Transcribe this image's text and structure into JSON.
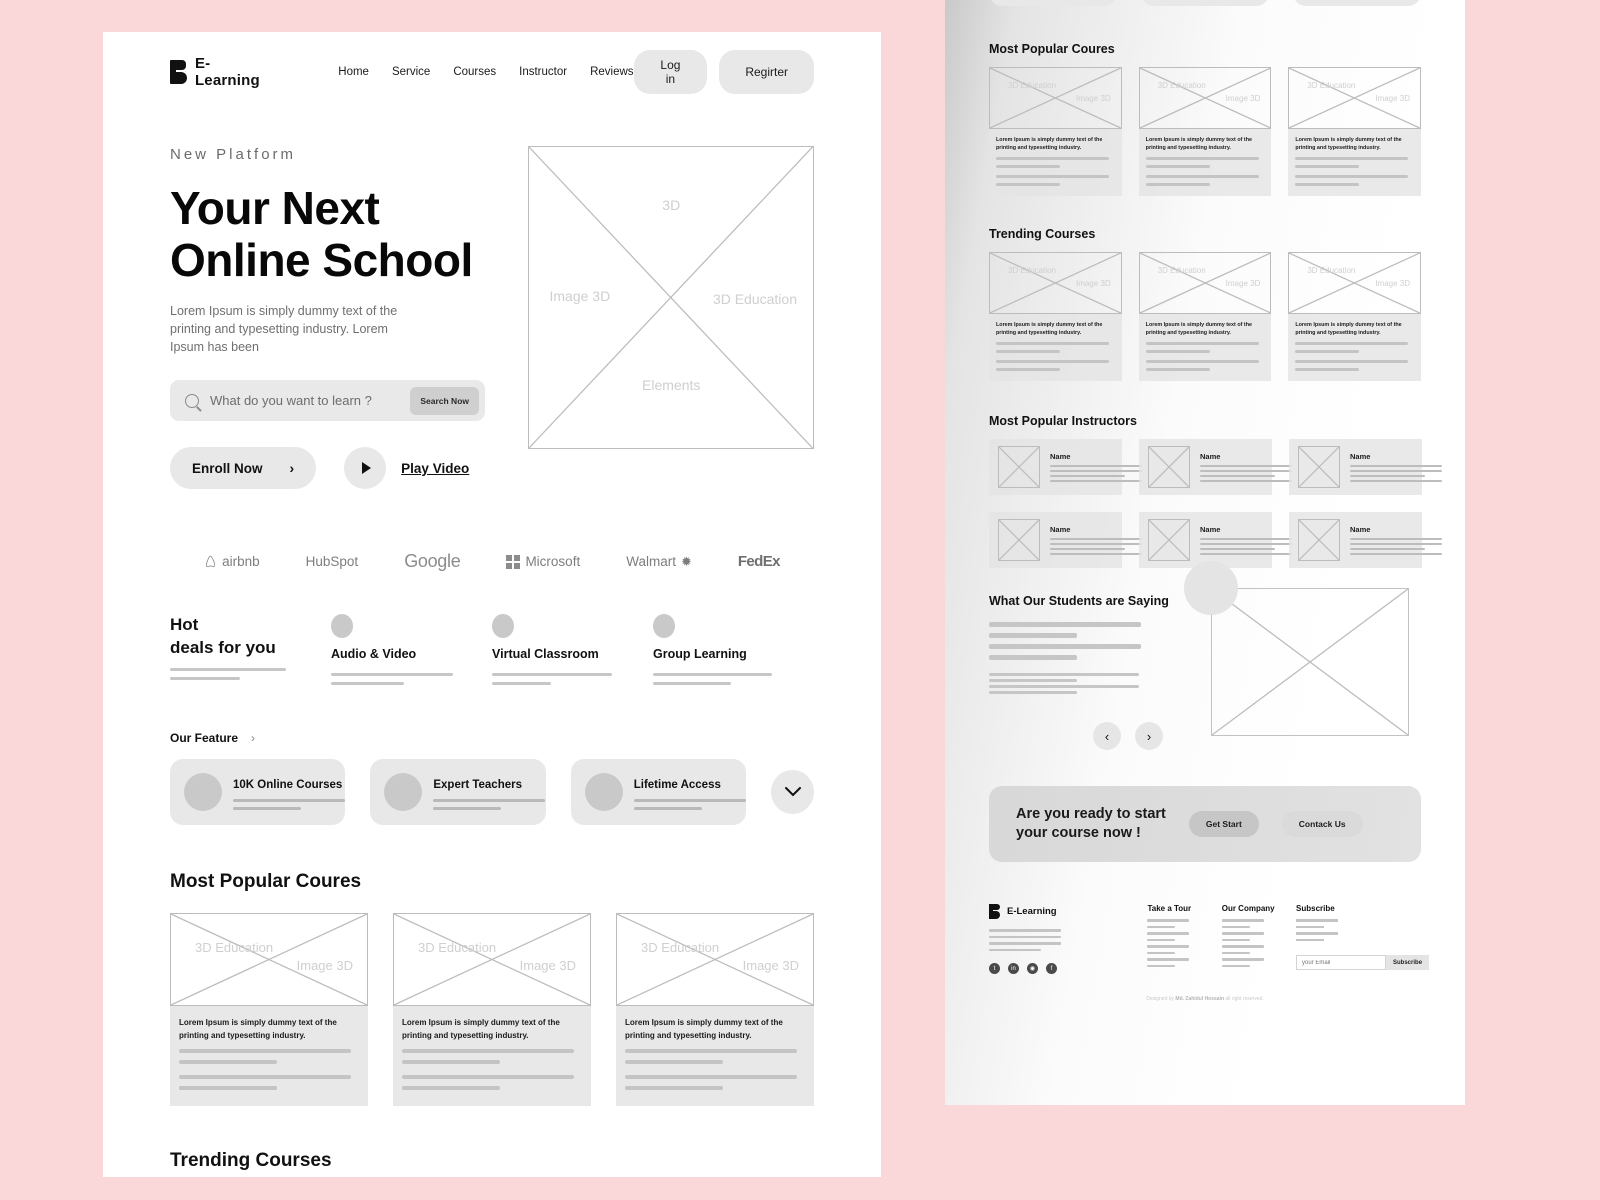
{
  "theme": {
    "page_bg": "#fad7d8",
    "card_bg": "#e8e8e8",
    "line": "#c4c4c4",
    "text": "#111111"
  },
  "brand": {
    "name": "E-Learning",
    "mark_icon": "b-logo-icon"
  },
  "nav": {
    "links": [
      "Home",
      "Service",
      "Courses",
      "Instructor",
      "Reviews"
    ],
    "login_label": "Log in",
    "register_label": "Regirter"
  },
  "hero": {
    "eyebrow": "New Platform",
    "title_line1": "Your Next",
    "title_line2": "Online School",
    "subtitle": "Lorem Ipsum is simply dummy text of the printing and typesetting industry. Lorem Ipsum has been",
    "search_placeholder": "What do you want to learn ?",
    "search_value": "",
    "search_button": "Search Now",
    "enroll_label": "Enroll Now",
    "play_label": "Play Video",
    "image_placeholder": {
      "top": "3D",
      "left": "Image 3D",
      "right": "3D Education",
      "bottom": "Elements"
    }
  },
  "logos": [
    "airbnb",
    "HubSpot",
    "Google",
    "Microsoft",
    "Walmart",
    "FedEx"
  ],
  "deals": {
    "title_line1": "Hot",
    "title_line2": "deals for you",
    "items": [
      {
        "label": "Audio & Video"
      },
      {
        "label": "Virtual Classroom"
      },
      {
        "label": "Group Learning"
      }
    ]
  },
  "feature": {
    "heading": "Our Feature",
    "chevron_icon": "chevron-right-icon",
    "cards": [
      {
        "title": "10K Online Courses"
      },
      {
        "title": "Expert Teachers"
      },
      {
        "title": "Lifetime Access"
      }
    ],
    "expand_icon": "chevron-down-icon"
  },
  "sections": {
    "popular_courses": "Most Popular Coures",
    "trending_courses": "Trending Courses",
    "popular_instructors": "Most Popular Instructors",
    "testimonials": "What Our Students are Saying"
  },
  "course_card": {
    "image_text_line1": "3D Education",
    "image_text_line2": "Image 3D",
    "body": "Lorem Ipsum is simply dummy text of the printing and typesetting industry."
  },
  "instructor_card": {
    "name": "Name"
  },
  "testimonial": {
    "prev_icon": "chevron-left-icon",
    "next_icon": "chevron-right-icon"
  },
  "cta": {
    "title_line1": "Are you ready to start",
    "title_line2": "your course now !",
    "primary_label": "Get Start",
    "secondary_label": "Contack Us"
  },
  "footer": {
    "brand": "E-Learning",
    "socials": [
      "twitter-icon",
      "linkedin-icon",
      "instagram-icon",
      "facebook-icon"
    ],
    "columns": [
      {
        "heading": "Take a Tour"
      },
      {
        "heading": "Our Company"
      }
    ],
    "subscribe": {
      "heading": "Subscribe",
      "placeholder": "your Email",
      "value": "",
      "button": "Subscribe"
    },
    "copyright_prefix": "Designed by ",
    "copyright_name": "Md. Zahidul Hossain",
    "copyright_suffix": " all right reserved."
  }
}
